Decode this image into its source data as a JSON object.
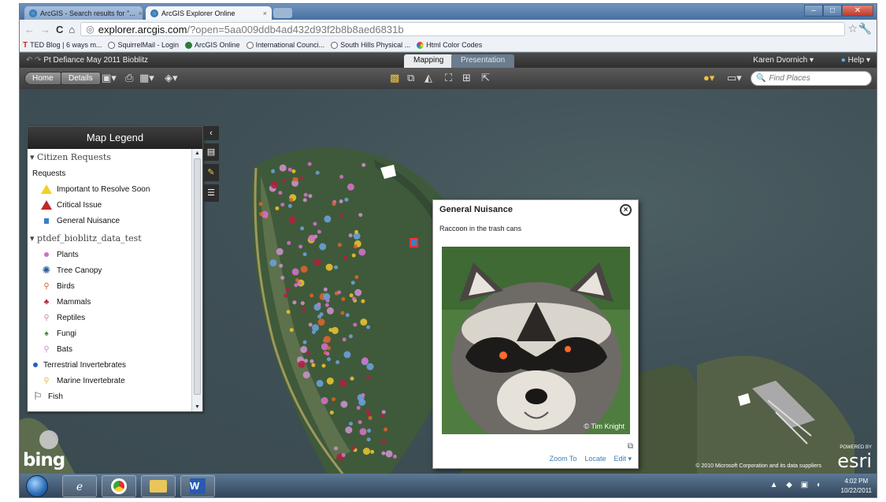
{
  "browser": {
    "tabs": [
      {
        "label": "ArcGIS - Search results for \"...",
        "active": false
      },
      {
        "label": "ArcGIS Explorer Online",
        "active": true
      }
    ],
    "url_host": "explorer.arcgis.com",
    "url_path": "/?open=5aa009ddb4ad432d93f2b8b8aed6831b",
    "bookmarks": [
      {
        "label": "TED Blog | 6 ways m...",
        "icon": "ted-icon"
      },
      {
        "label": "SquirrelMail - Login",
        "icon": "globe-icon"
      },
      {
        "label": "ArcGIS Online",
        "icon": "arcgis-globe-icon"
      },
      {
        "label": "International Counci...",
        "icon": "globe-icon"
      },
      {
        "label": "South Hills Physical ...",
        "icon": "globe-icon"
      },
      {
        "label": "Html Color Codes",
        "icon": "color-wheel-icon"
      }
    ]
  },
  "app": {
    "title": "Pt Defiance May 2011 Bioblitz",
    "modes": [
      "Mapping",
      "Presentation"
    ],
    "active_mode": "Mapping",
    "user": "Karen Dvornich ▾",
    "help": "Help ▾",
    "toolbar": {
      "home_label": "Home",
      "details_label": "Details",
      "search_placeholder": "Find Places"
    }
  },
  "legend": {
    "title": "Map Legend",
    "groups": [
      {
        "name": "Citizen Requests",
        "sublabel": "Requests",
        "items": [
          {
            "label": "Important to Resolve Soon",
            "icon": "warning-yellow-icon",
            "color": "#f2d028"
          },
          {
            "label": "Critical Issue",
            "icon": "warning-red-icon",
            "color": "#c0282a"
          },
          {
            "label": "General Nuisance",
            "icon": "square-blue-icon",
            "color": "#3c7fc8"
          }
        ]
      },
      {
        "name": "ptdef_bioblitz_data_test",
        "items": [
          {
            "label": "Plants",
            "icon": "dot-pink-icon",
            "color": "#d070c8"
          },
          {
            "label": "Tree Canopy",
            "icon": "tree-canopy-icon",
            "color": "#2a5d9c"
          },
          {
            "label": "Birds",
            "icon": "pin-orange-icon",
            "color": "#d8642a"
          },
          {
            "label": "Mammals",
            "icon": "pin-red-icon",
            "color": "#b02040"
          },
          {
            "label": "Reptiles",
            "icon": "pin-pink-icon",
            "color": "#d088b8"
          },
          {
            "label": "Fungi",
            "icon": "pin-green-icon",
            "color": "#3f8a3a"
          },
          {
            "label": "Bats",
            "icon": "pin-lavender-icon",
            "color": "#c890c8"
          },
          {
            "label": "Terrestrial Invertebrates",
            "icon": "dot-blue-icon",
            "color": "#2a5dc0"
          },
          {
            "label": "Marine Invertebrate",
            "icon": "pin-yellow-icon",
            "color": "#e8c030"
          },
          {
            "label": "Fish",
            "icon": "flag-icon",
            "color": "#333333"
          }
        ]
      }
    ]
  },
  "popup": {
    "title": "General Nuisance",
    "description": "Raccoon in the trash cans",
    "photo_credit": "© Tim Knight",
    "links": [
      "Zoom To",
      "Locate",
      "Edit ▾"
    ]
  },
  "map": {
    "basemap_logo": "bing",
    "copyright": "© 2010 Microsoft Corporation and its data suppliers",
    "esri_powered": "POWERED BY",
    "esri_logo": "esri"
  },
  "taskbar": {
    "apps": [
      "ie-icon",
      "chrome-icon",
      "explorer-folder-icon",
      "word-icon"
    ],
    "time": "4:02 PM",
    "date": "10/22/2011"
  }
}
